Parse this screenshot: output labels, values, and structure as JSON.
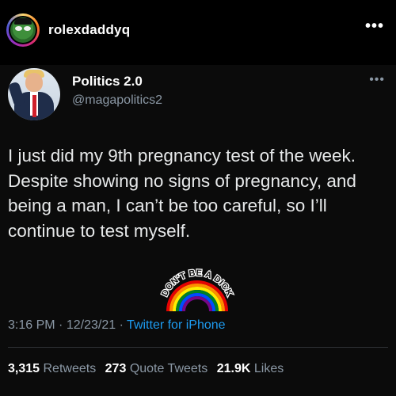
{
  "poster": {
    "username": "rolexdaddyq",
    "more_icon": "more-dots-icon"
  },
  "tweet": {
    "author_name": "Politics 2.0",
    "author_handle": "@magapolitics2",
    "more_icon": "more-dots-icon",
    "text": "I just did my 9th pregnancy test of the week. Despite showing no signs of pregnancy, and being a man, I can’t be too careful, so I’ll continue to test myself.",
    "sticker_text": "DON'T BE A DICK",
    "time": "3:16 PM",
    "date": "12/23/21",
    "separator": "·",
    "source": "Twitter for iPhone",
    "retweets_count": "3,315",
    "retweets_label": "Retweets",
    "quote_count": "273",
    "quote_label": "Quote Tweets",
    "likes_count": "21.9K",
    "likes_label": "Likes"
  },
  "colors": {
    "background": "#000000",
    "text": "#e7e9ea",
    "secondary": "#8b98a5",
    "link": "#1d9bf0"
  }
}
